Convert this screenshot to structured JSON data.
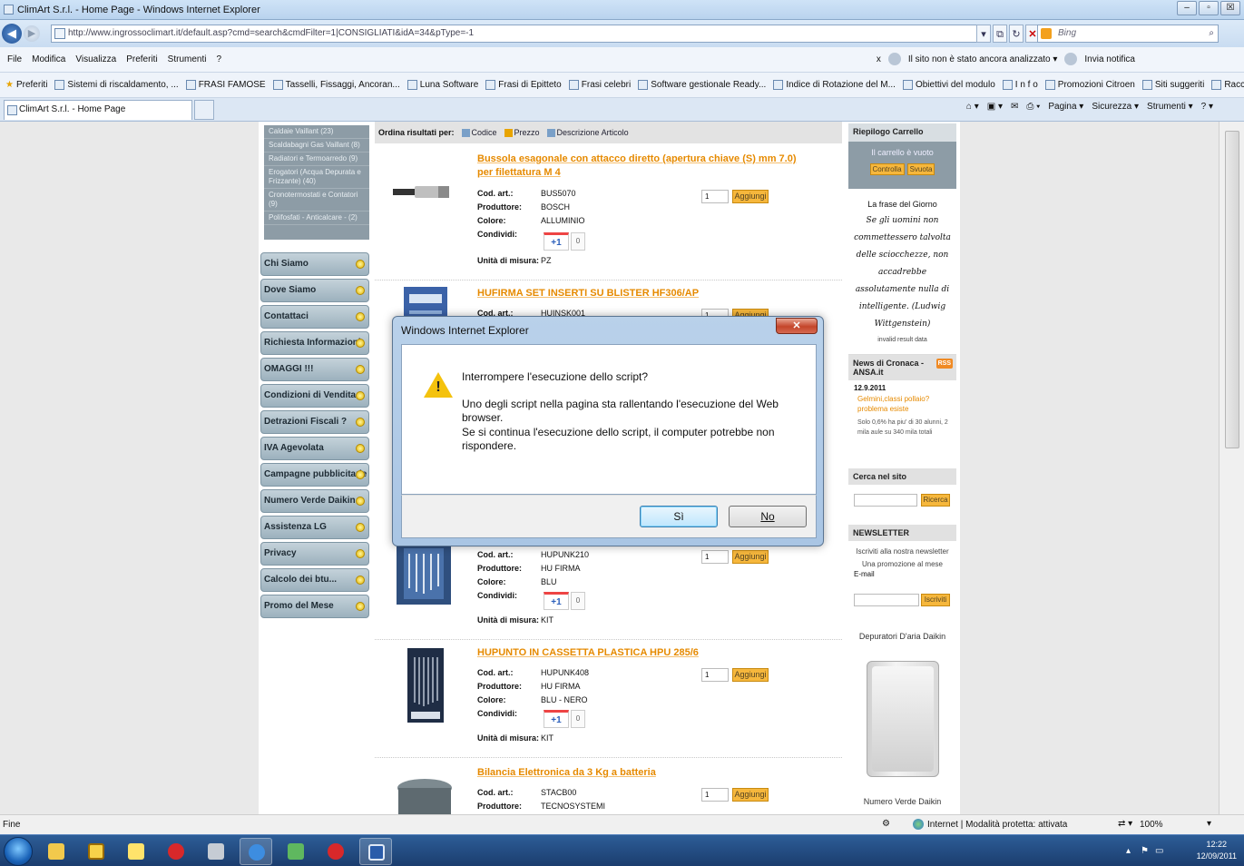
{
  "window": {
    "title": "ClimArt S.r.l. - Home Page - Windows Internet Explorer",
    "url": "http://www.ingrossoclimart.it/default.asp?cmd=search&cmdFilter=1|CONSIGLIATI&idA=34&pType=-1",
    "search_placeholder": "Bing",
    "controls": {
      "min": "–",
      "max": "▫",
      "close": "☒"
    }
  },
  "menubar": {
    "items": [
      "File",
      "Modifica",
      "Visualizza",
      "Preferiti",
      "Strumenti",
      "?"
    ],
    "status": "Il sito non è stato ancora analizzato ▾",
    "notify": "Invia notifica"
  },
  "favorites": {
    "label": "Preferiti",
    "items": [
      "Sistemi di riscaldamento, ...",
      "FRASI FAMOSE",
      "Tasselli, Fissaggi, Ancoran...",
      "Luna Software",
      "Frasi di Epitteto",
      "Frasi celebri",
      "Software gestionale Ready...",
      "Indice di Rotazione del M...",
      "Obiettivi del modulo",
      "I n f o",
      "Promozioni Citroen",
      "Siti suggeriti",
      "Raccolta Web Slice"
    ]
  },
  "tabs": [
    {
      "label": "ClimArt S.r.l. - Home Page"
    }
  ],
  "commandbar": [
    "Pagina ▾",
    "Sicurezza ▾",
    "Strumenti ▾"
  ],
  "sidebar": {
    "categories": [
      "Caldaie Vaillant (23)",
      "Scaldabagni Gas Vaillant (8)",
      "Radiatori e Termoarredo (9)",
      "Erogatori (Acqua Depurata e Frizzante) (40)",
      "Cronotermostati e Contatori (9)",
      "Polifosfati - Anticalcare - (2)"
    ],
    "links": [
      "Chi Siamo",
      "Dove Siamo",
      "Contattaci",
      "Richiesta Informazioni",
      "OMAGGI !!!",
      "Condizioni di Vendita",
      "Detrazioni Fiscali ?",
      "IVA Agevolata",
      "Campagne pubblicitarie",
      "Numero Verde Daikin",
      "Assistenza LG",
      "Privacy",
      "Calcolo dei btu...",
      "Promo del Mese"
    ]
  },
  "sort": {
    "label": "Ordina risultati per:",
    "options": [
      "Codice",
      "Prezzo",
      "Descrizione Articolo"
    ]
  },
  "product_labels": {
    "code": "Cod. art.:",
    "maker": "Produttore:",
    "color": "Colore:",
    "share": "Condividi:",
    "unit": "Unità di misura:",
    "add": "Aggiungi",
    "plus": "+1"
  },
  "products": [
    {
      "name": "Bussola esagonale con attacco diretto (apertura chiave (S) mm 7.0) per filettatura M 4",
      "code": "BUS5070",
      "maker": "BOSCH",
      "color": "ALLUMINIO",
      "unit": "PZ",
      "qty": "1",
      "shares": "0"
    },
    {
      "name": "HUFIRMA SET INSERTI SU BLISTER HF306/AP",
      "code": "HUINSK001",
      "qty": "1"
    },
    {
      "code": "HUPUNK210",
      "maker": "HU FIRMA",
      "color": "BLU",
      "unit": "KIT",
      "qty": "1",
      "shares": "0"
    },
    {
      "name": "HUPUNTO IN CASSETTA PLASTICA HPU 285/6",
      "code": "HUPUNK408",
      "maker": "HU FIRMA",
      "color": "BLU - NERO",
      "unit": "KIT",
      "qty": "1",
      "shares": "0"
    },
    {
      "name": "Bilancia Elettronica da 3 Kg a batteria",
      "code": "STACB00",
      "maker": "TECNOSYSTEMI",
      "qty": "1"
    }
  ],
  "right": {
    "cart_title": "Riepilogo Carrello",
    "cart_empty": "Il carrello è vuoto",
    "cart_buttons": [
      "Controlla",
      "Svuota"
    ],
    "phrase_title": "La frase del Giorno",
    "phrase": "Se gli uomini non commettessero talvolta delle sciocchezze, non accadrebbe assolutamente nulla di intelligente. (Ludwig Wittgenstein)",
    "invalid": "invalid result data",
    "news_title": "News di Cronaca - ANSA.it",
    "rss": "RSS",
    "news_date": "12.9.2011",
    "news_link": "Gelmini,classi pollaio? problema esiste",
    "news_body": "Solo 0,6% ha piu' di 30 alunni, 2 mila aule su 340 mila totali",
    "search_title": "Cerca nel sito",
    "search_button": "Ricerca",
    "newsletter_title": "NEWSLETTER",
    "newsletter_text": "Iscriviti alla nostra newsletter",
    "newsletter_promo": "Una promozione al mese",
    "email_label": "E-mail",
    "newsletter_button": "Iscriviti",
    "promo_title": "Depuratori D'aria Daikin",
    "numverde": "Numero Verde Daikin"
  },
  "dialog": {
    "title": "Windows Internet Explorer",
    "question": "Interrompere l'esecuzione dello script?",
    "text": "Uno degli script nella pagina sta rallentando l'esecuzione del Web browser.",
    "text2": "Se si continua l'esecuzione dello script, il computer potrebbe non rispondere.",
    "yes": "Sì",
    "no": "No",
    "close": "✕"
  },
  "statusbar": {
    "left": "Fine",
    "zone": "Internet | Modalità protetta: attivata",
    "zoom": "100%"
  },
  "clock": {
    "time": "12:22",
    "date": "12/09/2011"
  },
  "colors": {
    "accent": "#e68a00",
    "nav": "#9cb1bd",
    "button": "#f6b73c"
  }
}
